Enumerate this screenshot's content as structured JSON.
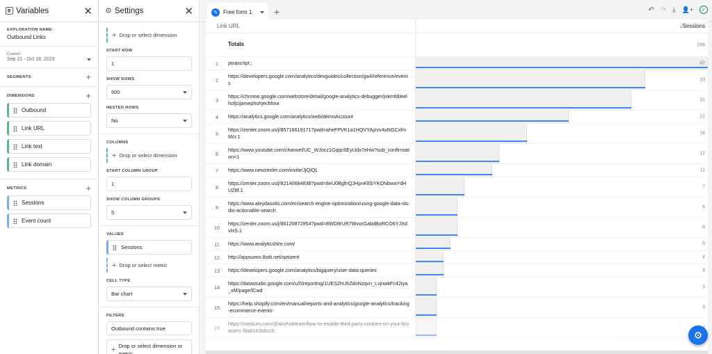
{
  "variables": {
    "title": "Variables",
    "exploration_name_label": "EXPLORATION NAME:",
    "exploration_name": "Outbound Links",
    "date_type": "Custom",
    "date_range": "Sep 21 - Oct 18, 2023",
    "segments_label": "SEGMENTS",
    "dimensions_label": "DIMENSIONS",
    "dimensions": [
      "Outbound",
      "Link URL",
      "Link text",
      "Link domain"
    ],
    "metrics_label": "METRICS",
    "metrics": [
      "Sessions",
      "Event count"
    ]
  },
  "settings": {
    "title": "Settings",
    "drop_dimension": "Drop or select dimension",
    "start_row_label": "START ROW",
    "start_row": "1",
    "show_rows_label": "SHOW ROWS",
    "show_rows": "500",
    "nested_rows_label": "NESTED ROWS",
    "nested_rows": "No",
    "columns_label": "COLUMNS",
    "start_column_group_label": "START COLUMN GROUP",
    "start_column_group": "1",
    "show_column_groups_label": "SHOW COLUMN GROUPS",
    "show_column_groups": "5",
    "values_label": "VALUES",
    "value_metric": "Sessions",
    "drop_metric": "Drop or select metric",
    "cell_type_label": "CELL TYPE",
    "cell_type": "Bar chart",
    "filters_label": "FILTERS",
    "filter": "Outbound contains true",
    "drop_dim_or_metric_1": "Drop or select dimension or",
    "drop_dim_or_metric_2": "metric"
  },
  "main": {
    "tab_label": "Free form 1",
    "col_dimension": "Link URL",
    "col_metric": "↓Sessions",
    "totals_label": "Totals",
    "totals_value": "266",
    "max_value": 42,
    "rows": [
      {
        "n": "1",
        "url": "javascript:;",
        "v": 42
      },
      {
        "n": "2",
        "url": "https://developers.google.com/analytics/devguides/collection/ga4/reference/events",
        "v": 33
      },
      {
        "n": "3",
        "url": "https://chrome.google.com/webstore/detail/google-analytics-debugger/jnkmfdileelhofjcijamephohjechhna",
        "v": 31
      },
      {
        "n": "4",
        "url": "https://analytics.google.com/analytics/web/demoAccount",
        "v": 22
      },
      {
        "n": "5",
        "url": "https://zenler.zoom.us/j/85716619171?pwd=aheFPVK1a1HQVYAjzvs4uNGCxfmMcr.1",
        "v": 16
      },
      {
        "n": "6",
        "url": "https://www.youtube.com/channel/UC_WJocz1Gqqc6EyIJdx7eHw?sub_confirmation=1",
        "v": 12
      },
      {
        "n": "7",
        "url": "https://www.newzenler.com/invite/JjQlQL",
        "v": 11
      },
      {
        "n": "8",
        "url": "https://zenler.zoom.us/j/82140684838?pwd=8eU0BgfnQJHpnKEbYKONbwaYdHUZ8f.1",
        "v": 7
      },
      {
        "n": "9",
        "url": "https://www.aleydasolis.com/en/search-engine-optimization/using-google-data-studio-actionable-search",
        "v": 6
      },
      {
        "n": "10",
        "url": "https://zenler.zoom.us/j/86120872954?pwd=8WD8rUR7WvorGabdBoRCO6YJXdvIxS.1",
        "v": 6
      },
      {
        "n": "11",
        "url": "https://www.analyticshire.com/",
        "v": 5
      },
      {
        "n": "12",
        "url": "http://appsumo.8odi.net/optizent",
        "v": 4
      },
      {
        "n": "13",
        "url": "https://developers.google.com/analytics/bigquery/user-data-queries",
        "v": 4
      },
      {
        "n": "14",
        "url": "https://datastudio.google.com/u/0/reporting/1UES2hUhZdoNzqvn_LvjnwkFc42iya_xM/page/lCwd",
        "v": 3
      },
      {
        "n": "15",
        "url": "https://help.shopify.com/en/manual/reports-and-analytics/google-analytics/tracking-ecommerce-events-",
        "v": 3
      },
      {
        "n": "16",
        "url": "https://medium.com/@akohubteam/how-to-enable-third-party-cookies-on-your-browsers-f9a8143b8cc5",
        "v": 3
      }
    ]
  },
  "icons": {
    "close": "✕",
    "plus": "+",
    "undo": "↶",
    "redo": "↷",
    "download": "⤓",
    "share": "👤+",
    "check": "✓",
    "edit": "✎",
    "fab": "⚙"
  }
}
